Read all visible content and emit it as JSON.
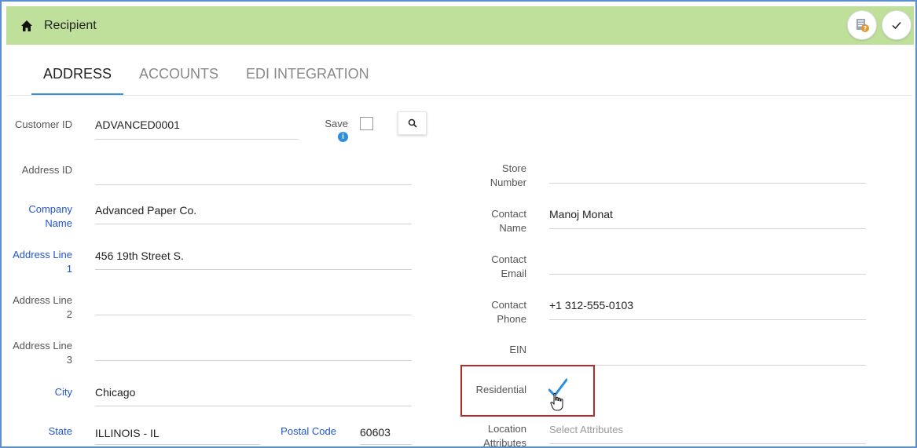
{
  "header": {
    "title": "Recipient"
  },
  "tabs": [
    {
      "label": "ADDRESS",
      "active": true
    },
    {
      "label": "ACCOUNTS",
      "active": false
    },
    {
      "label": "EDI INTEGRATION",
      "active": false
    }
  ],
  "form_left": {
    "customer_id": {
      "label": "Customer ID",
      "value": "ADVANCED0001"
    },
    "save": {
      "label": "Save",
      "checked": false
    },
    "address_id": {
      "label": "Address ID",
      "value": ""
    },
    "company_name": {
      "label": "Company Name",
      "value": "Advanced Paper Co."
    },
    "address_line1": {
      "label": "Address Line 1",
      "value": "456 19th Street S."
    },
    "address_line2": {
      "label": "Address Line 2",
      "value": ""
    },
    "address_line3": {
      "label": "Address Line 3",
      "value": ""
    },
    "city": {
      "label": "City",
      "value": "Chicago"
    },
    "state": {
      "label": "State",
      "value": "ILLINOIS - IL"
    },
    "postal_code": {
      "label": "Postal Code",
      "value": "60603"
    }
  },
  "form_right": {
    "store_number": {
      "label": "Store Number",
      "value": ""
    },
    "contact_name": {
      "label": "Contact Name",
      "value": "Manoj Monat"
    },
    "contact_email": {
      "label": "Contact Email",
      "value": ""
    },
    "contact_phone": {
      "label": "Contact Phone",
      "value": "+1 312-555-0103"
    },
    "ein": {
      "label": "EIN",
      "value": ""
    },
    "residential": {
      "label": "Residential",
      "checked": true
    },
    "location_attributes": {
      "label": "Location Attributes",
      "placeholder": "Select Attributes"
    }
  },
  "colors": {
    "header_bg": "#bfe09a",
    "required_label": "#2255cc",
    "active_tab_underline": "#3a8fd8",
    "checkmark": "#2a8fe0",
    "highlight": "#b52a2a"
  }
}
